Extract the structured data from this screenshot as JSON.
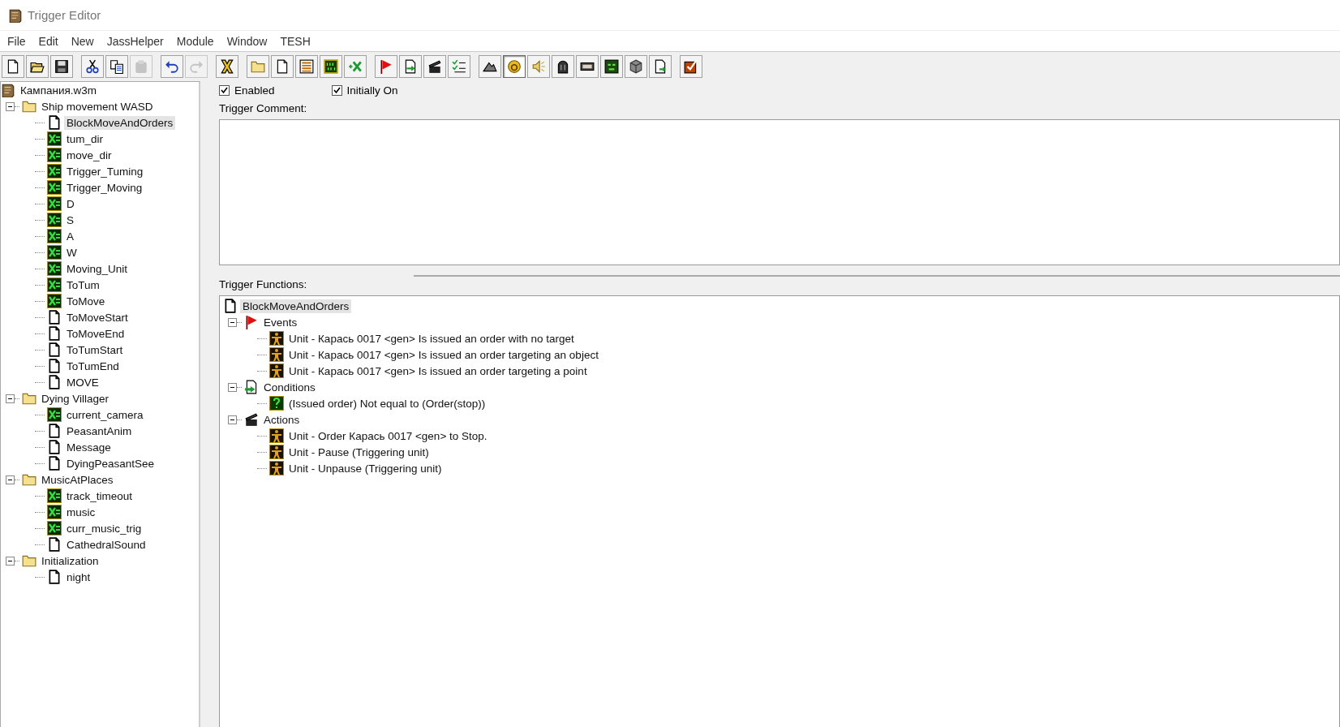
{
  "window": {
    "title": "Trigger Editor"
  },
  "menu": [
    "File",
    "Edit",
    "New",
    "JassHelper",
    "Module",
    "Window",
    "TESH"
  ],
  "toolbar": [
    [
      {
        "kind": "new",
        "pressed": false,
        "disabled": false
      },
      {
        "kind": "open",
        "pressed": false,
        "disabled": false
      },
      {
        "kind": "save",
        "pressed": false,
        "disabled": false
      }
    ],
    [
      {
        "kind": "cut",
        "pressed": false,
        "disabled": false
      },
      {
        "kind": "copy",
        "pressed": false,
        "disabled": false
      },
      {
        "kind": "paste",
        "pressed": false,
        "disabled": true
      }
    ],
    [
      {
        "kind": "undo",
        "pressed": false,
        "disabled": false
      },
      {
        "kind": "redo",
        "pressed": false,
        "disabled": true
      }
    ],
    [
      {
        "kind": "bigx",
        "pressed": false,
        "disabled": false
      }
    ],
    [
      {
        "kind": "folder",
        "pressed": false,
        "disabled": false
      },
      {
        "kind": "page",
        "pressed": false,
        "disabled": false
      },
      {
        "kind": "lines",
        "pressed": false,
        "disabled": false
      },
      {
        "kind": "binary",
        "pressed": false,
        "disabled": false
      },
      {
        "kind": "varadd",
        "pressed": false,
        "disabled": false
      }
    ],
    [
      {
        "kind": "flag",
        "pressed": false,
        "disabled": false
      },
      {
        "kind": "condition",
        "pressed": false,
        "disabled": false
      },
      {
        "kind": "clapper",
        "pressed": false,
        "disabled": false
      },
      {
        "kind": "checklist",
        "pressed": false,
        "disabled": false
      }
    ],
    [
      {
        "kind": "terrain",
        "pressed": false,
        "disabled": false
      },
      {
        "kind": "letter",
        "pressed": true,
        "disabled": false
      },
      {
        "kind": "speaker",
        "pressed": false,
        "disabled": false
      },
      {
        "kind": "head",
        "pressed": false,
        "disabled": false
      },
      {
        "kind": "panel",
        "pressed": false,
        "disabled": false
      },
      {
        "kind": "monster",
        "pressed": false,
        "disabled": false
      },
      {
        "kind": "cube",
        "pressed": false,
        "disabled": false
      },
      {
        "kind": "docarrow",
        "pressed": false,
        "disabled": false
      }
    ],
    [
      {
        "kind": "redcheck",
        "pressed": false,
        "disabled": false
      }
    ]
  ],
  "tree": {
    "label": "Кампания.w3m",
    "kind": "map",
    "selected": false,
    "children": [
      {
        "label": "Ship movement WASD",
        "kind": "folder",
        "selected": false,
        "expanded": true,
        "children": [
          {
            "label": "BlockMoveAndOrders",
            "kind": "trigger",
            "selected": true
          },
          {
            "label": "tum_dir",
            "kind": "variable",
            "selected": false
          },
          {
            "label": "move_dir",
            "kind": "variable",
            "selected": false
          },
          {
            "label": "Trigger_Tuming",
            "kind": "variable",
            "selected": false
          },
          {
            "label": "Trigger_Moving",
            "kind": "variable",
            "selected": false
          },
          {
            "label": "D",
            "kind": "variable",
            "selected": false
          },
          {
            "label": "S",
            "kind": "variable",
            "selected": false
          },
          {
            "label": "A",
            "kind": "variable",
            "selected": false
          },
          {
            "label": "W",
            "kind": "variable",
            "selected": false
          },
          {
            "label": "Moving_Unit",
            "kind": "variable",
            "selected": false
          },
          {
            "label": "ToTum",
            "kind": "variable",
            "selected": false
          },
          {
            "label": "ToMove",
            "kind": "variable",
            "selected": false
          },
          {
            "label": "ToMoveStart",
            "kind": "trigger",
            "selected": false
          },
          {
            "label": "ToMoveEnd",
            "kind": "trigger",
            "selected": false
          },
          {
            "label": "ToTumStart",
            "kind": "trigger",
            "selected": false
          },
          {
            "label": "ToTumEnd",
            "kind": "trigger",
            "selected": false
          },
          {
            "label": "MOVE",
            "kind": "trigger",
            "selected": false
          }
        ]
      },
      {
        "label": "Dying Villager",
        "kind": "folder",
        "selected": false,
        "expanded": true,
        "children": [
          {
            "label": "current_camera",
            "kind": "variable",
            "selected": false
          },
          {
            "label": "PeasantAnim",
            "kind": "trigger",
            "selected": false
          },
          {
            "label": "Message",
            "kind": "trigger",
            "selected": false
          },
          {
            "label": "DyingPeasantSee",
            "kind": "trigger",
            "selected": false
          }
        ]
      },
      {
        "label": "MusicAtPlaces",
        "kind": "folder",
        "selected": false,
        "expanded": true,
        "children": [
          {
            "label": "track_timeout",
            "kind": "variable",
            "selected": false
          },
          {
            "label": "music",
            "kind": "variable",
            "selected": false
          },
          {
            "label": "curr_music_trig",
            "kind": "variable",
            "selected": false
          },
          {
            "label": "CathedralSound",
            "kind": "trigger",
            "selected": false
          }
        ]
      },
      {
        "label": "Initialization",
        "kind": "folder",
        "selected": false,
        "expanded": true,
        "children": [
          {
            "label": "night",
            "kind": "trigger",
            "selected": false
          }
        ]
      }
    ]
  },
  "options": [
    {
      "label": "Enabled",
      "checked": true
    },
    {
      "label": "Initially On",
      "checked": true
    }
  ],
  "comment": {
    "label": "Trigger Comment:"
  },
  "functions": {
    "label": "Trigger Functions:",
    "tree": {
      "label": "BlockMoveAndOrders",
      "kind": "trigger",
      "selected": true,
      "children": [
        {
          "label": "Events",
          "kind": "events",
          "selected": false,
          "expanded": true,
          "children": [
            {
              "label": "Unit - Карась 0017 <gen> Is issued an order with no target",
              "kind": "unit",
              "selected": false
            },
            {
              "label": "Unit - Карась 0017 <gen> Is issued an order targeting an object",
              "kind": "unit",
              "selected": false
            },
            {
              "label": "Unit - Карась 0017 <gen> Is issued an order targeting a point",
              "kind": "unit",
              "selected": false
            }
          ]
        },
        {
          "label": "Conditions",
          "kind": "conditions",
          "selected": false,
          "expanded": true,
          "children": [
            {
              "label": "(Issued order) Not equal to (Order(stop))",
              "kind": "question",
              "selected": false
            }
          ]
        },
        {
          "label": "Actions",
          "kind": "actions",
          "selected": false,
          "expanded": true,
          "children": [
            {
              "label": "Unit - Order Карась 0017 <gen> to Stop.",
              "kind": "unit",
              "selected": false
            },
            {
              "label": "Unit - Pause (Triggering unit)",
              "kind": "unit",
              "selected": false
            },
            {
              "label": "Unit - Unpause (Triggering unit)",
              "kind": "unit",
              "selected": false
            }
          ]
        }
      ]
    }
  }
}
